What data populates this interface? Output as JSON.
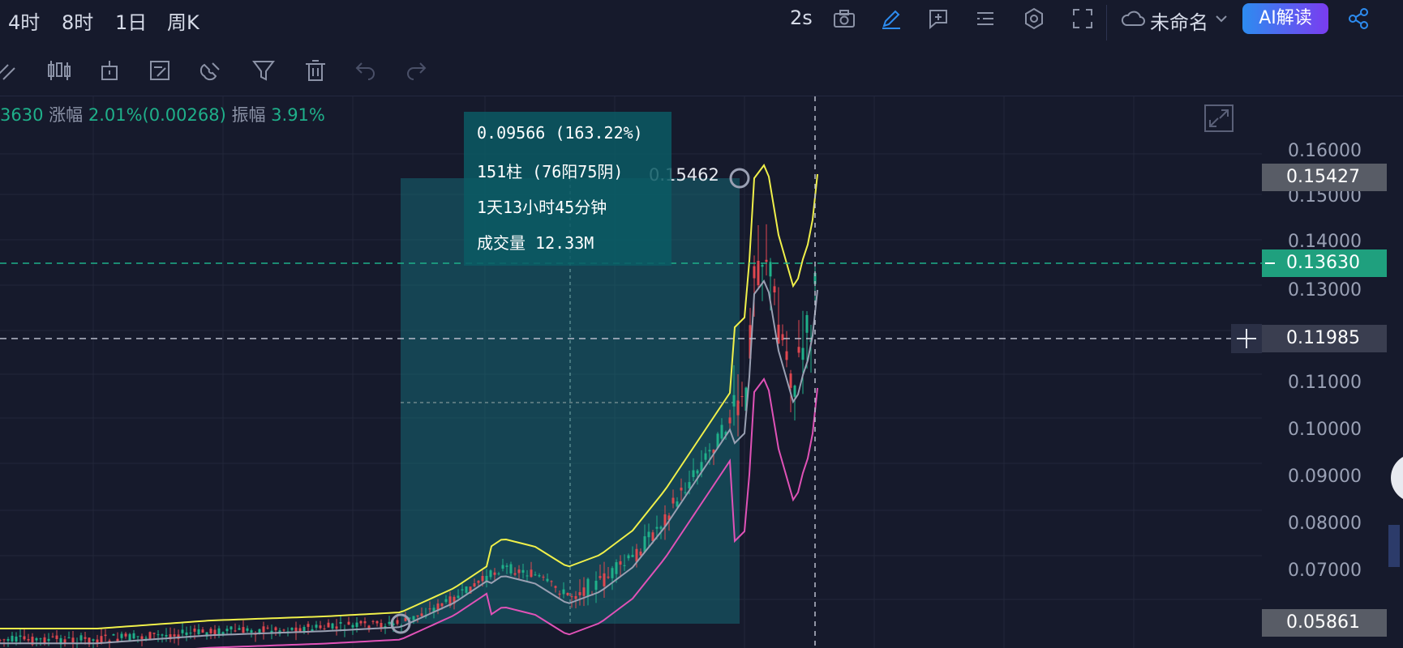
{
  "topbar": {
    "timeframes": [
      "4时",
      "8时",
      "1日",
      "周K"
    ],
    "refresh": "2s",
    "layout_name": "未命名",
    "ai_button": "AI解读",
    "icons": [
      "camera-icon",
      "pencil-icon",
      "add-panel-icon",
      "list-icon",
      "settings-icon",
      "fullscreen-icon",
      "cloud-icon",
      "chevron-down-icon",
      "share-icon"
    ]
  },
  "toolbar": {
    "icons": [
      "drawing-icon",
      "candlestick-icon",
      "indicator-icon",
      "edit-template-icon",
      "magnet-icon",
      "filter-icon",
      "trash-icon",
      "undo-icon",
      "redo-icon"
    ]
  },
  "info": {
    "price": "3630",
    "change_label": "涨幅",
    "change_value": "2.01%(0.00268)",
    "amplitude_label": "振幅",
    "amplitude_value": "3.91%"
  },
  "measure": {
    "line1": "0.09566 (163.22%)",
    "line2": "151柱 (76阳75阴)",
    "line3": "1天13小时45分钟",
    "line4": "成交量 12.33M"
  },
  "annotation": {
    "high_label": "0.15462"
  },
  "price_axis": {
    "ticks": [
      "0.16000",
      "0.15000",
      "0.14000",
      "0.13000",
      "0.11000",
      "0.10000",
      "0.09000",
      "0.08000",
      "0.07000"
    ],
    "tags": {
      "top": "0.15427",
      "current": "0.13630",
      "cursor": "0.11985",
      "bottom": "0.05861"
    }
  },
  "colors": {
    "up": "#1fb08a",
    "down": "#e0474f",
    "measure_box": "#0b5a64",
    "current_tag": "#1fb08a",
    "upper_band": "#f0f04a",
    "mid_band": "#9aa0b3",
    "lower_band": "#e052b7"
  }
}
